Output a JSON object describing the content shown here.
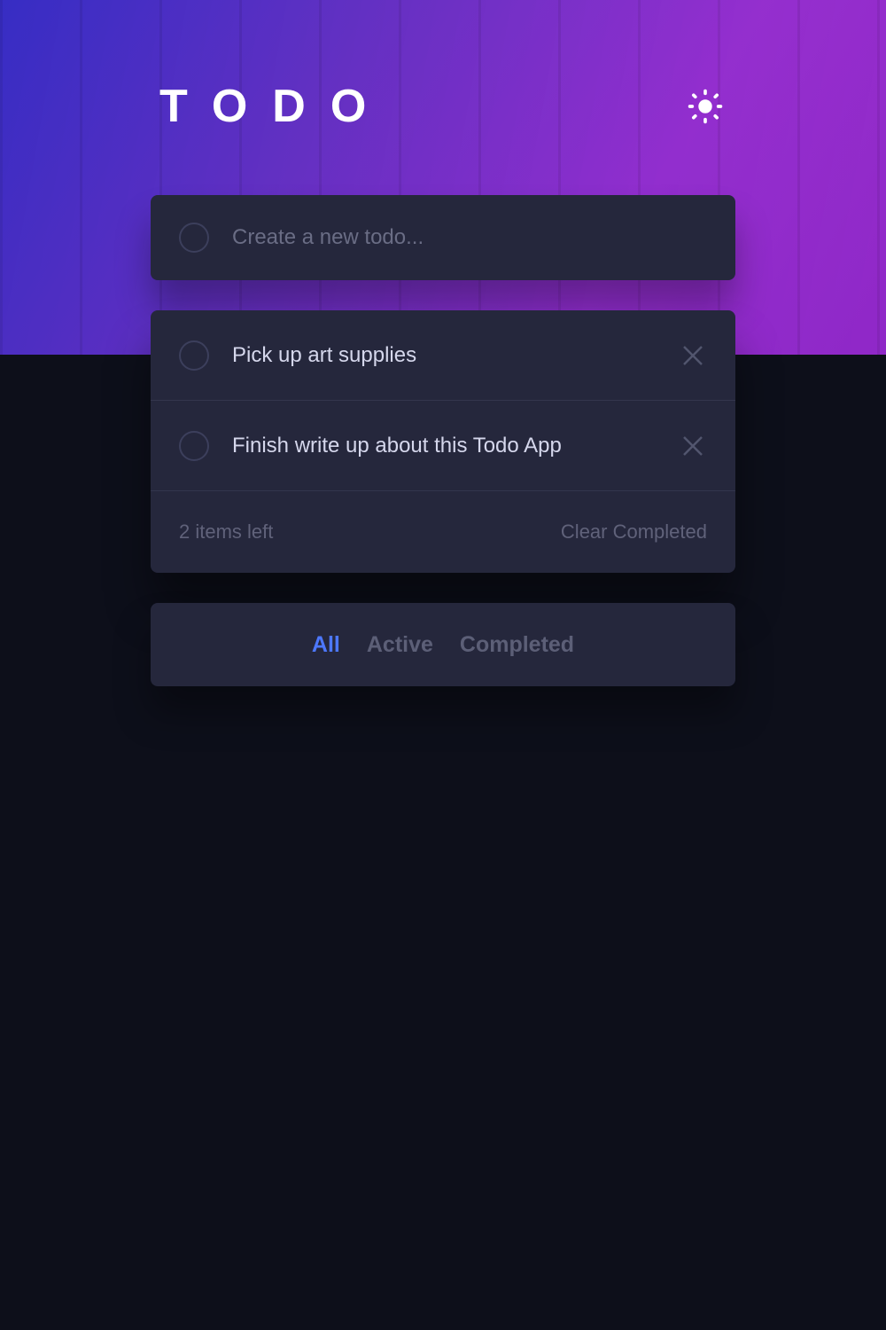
{
  "header": {
    "title": "TODO"
  },
  "input": {
    "placeholder": "Create a new todo..."
  },
  "todos": [
    {
      "label": "Pick up art supplies",
      "completed": false
    },
    {
      "label": "Finish write up about this Todo App",
      "completed": false
    }
  ],
  "footer": {
    "items_left": "2 items left",
    "clear": "Clear Completed"
  },
  "filters": {
    "all": "All",
    "active": "Active",
    "completed": "Completed",
    "current": "all"
  }
}
